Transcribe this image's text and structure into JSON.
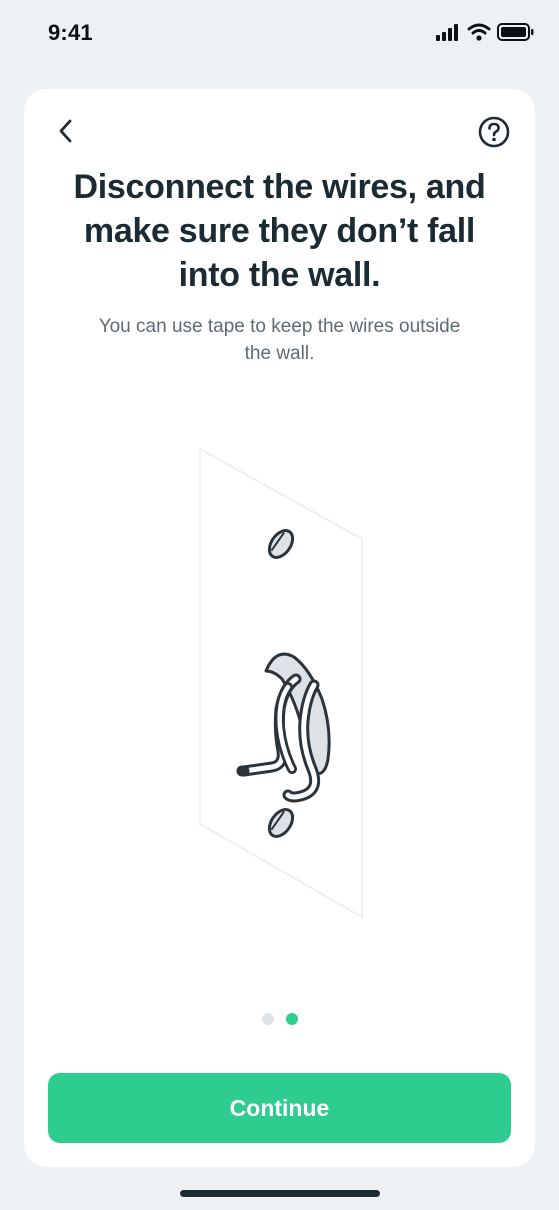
{
  "status_bar": {
    "time": "9:41",
    "icons": [
      "signal-icon",
      "wifi-icon",
      "battery-icon"
    ]
  },
  "header": {
    "back_icon": "chevron-left-icon",
    "help_icon": "question-circle-icon"
  },
  "content": {
    "title": "Disconnect the wires, and make sure they don’t fall into the wall.",
    "subtitle": "You can use tape to keep the wires outside the wall."
  },
  "illustration": {
    "name": "wall-plate-with-taped-wires-illustration"
  },
  "pager": {
    "total": 2,
    "current": 2
  },
  "footer": {
    "continue_label": "Continue"
  },
  "colors": {
    "accent": "#2ecc8f",
    "title": "#1b2a33",
    "subtitle": "#5e6b73",
    "background": "#eef1f4",
    "dot_inactive": "#dfe3e6"
  }
}
